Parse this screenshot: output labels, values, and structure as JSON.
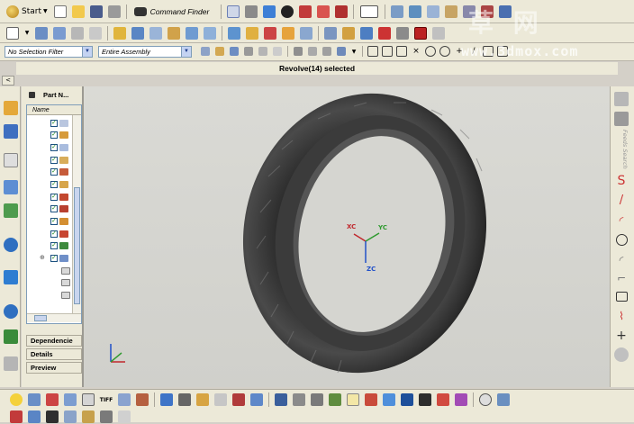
{
  "toolbar": {
    "start_label": "Start",
    "command_finder_label": "Command Finder"
  },
  "filters": {
    "selection_filter": "No Selection Filter",
    "scope": "Entire Assembly"
  },
  "status": {
    "message": "Revolve(14) selected"
  },
  "navigator": {
    "title": "Part N...",
    "column_name": "Name",
    "sections": [
      "Dependencie",
      "Details",
      "Preview"
    ]
  },
  "right_rail": {
    "vertical_label": "Feeds Search"
  },
  "csys": {
    "xc": "XC",
    "yc": "YC",
    "zc": "ZC"
  },
  "watermark": {
    "text": "草 网",
    "url": "www.3dmox.com"
  },
  "colors": {
    "chrome": "#ece9d8",
    "viewport": "#d4d4cf",
    "accent_blue": "#316ac5",
    "axis_x": "#c0282d",
    "axis_y": "#2f9a2f",
    "axis_z": "#2050c8"
  }
}
